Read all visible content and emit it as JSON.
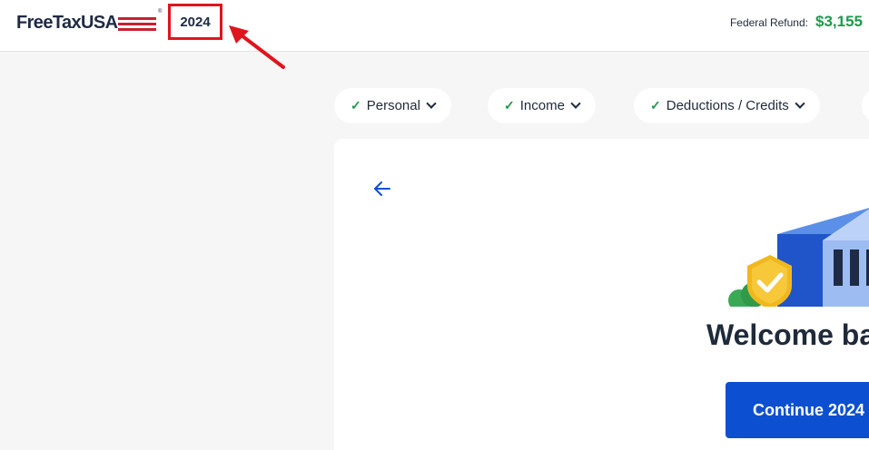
{
  "header": {
    "logo_text": "FreeTaxUSA",
    "logo_reg": "®",
    "tax_year": "2024",
    "refund_label": "Federal Refund:",
    "refund_amount": "$3,155"
  },
  "steps": [
    {
      "label": "Personal",
      "icon": "check-icon",
      "status": "complete"
    },
    {
      "label": "Income",
      "icon": "check-icon",
      "status": "complete"
    },
    {
      "label": "Deductions / Credits",
      "icon": "check-icon",
      "status": "complete"
    }
  ],
  "main": {
    "heading": "Welcome ba",
    "continue_label": "Continue 2024"
  },
  "colors": {
    "accent_blue": "#0d4fd1",
    "refund_green": "#1b9b4a",
    "annotation_red": "#e0141d"
  }
}
